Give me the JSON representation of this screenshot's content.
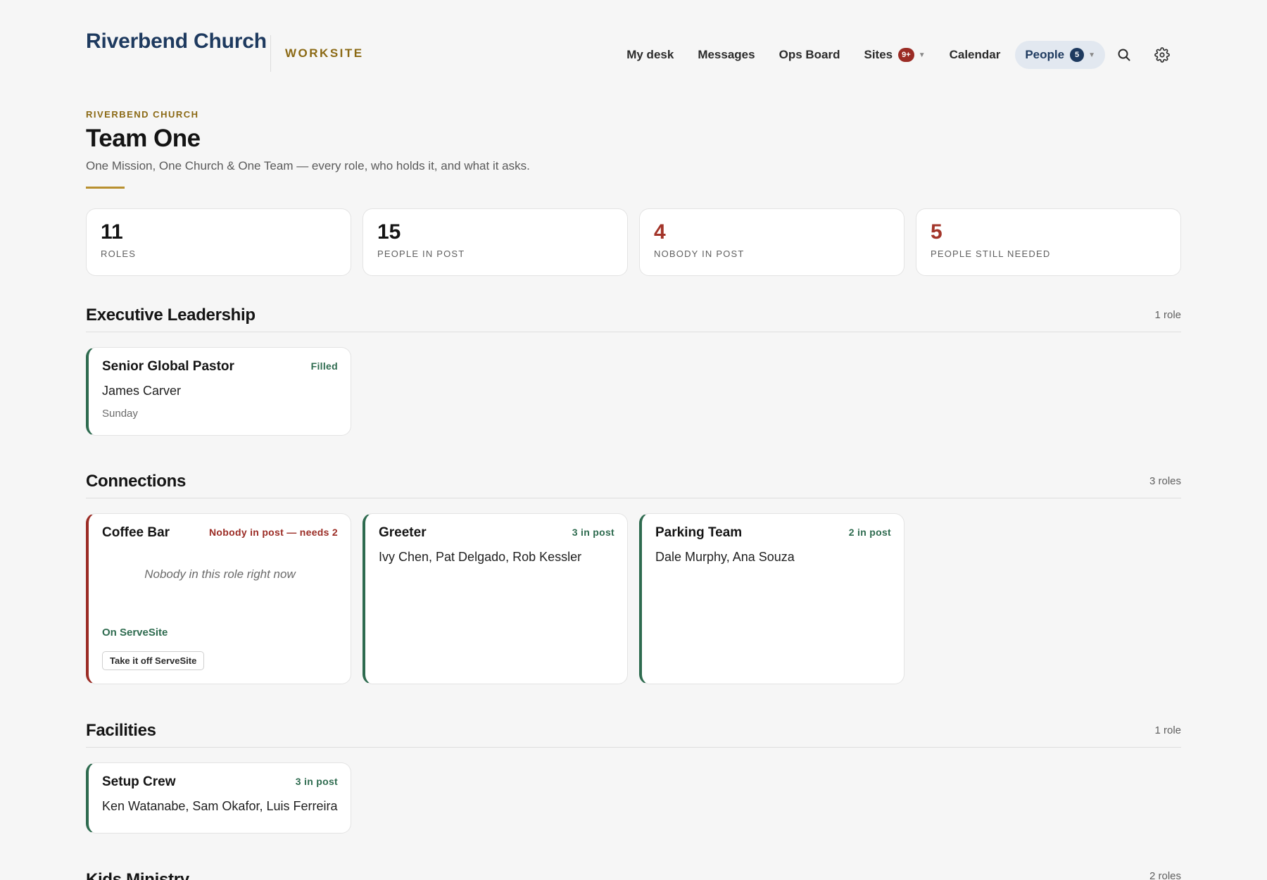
{
  "header": {
    "brand": "Riverbend Church",
    "workspace": "WORKSITE",
    "nav": {
      "my_desk": "My desk",
      "messages": "Messages",
      "ops_board": "Ops Board",
      "sites": "Sites",
      "sites_badge": "9+",
      "calendar": "Calendar",
      "people": "People",
      "people_badge": "5"
    }
  },
  "page": {
    "eyebrow": "RIVERBEND CHURCH",
    "title": "Team One",
    "subtitle": "One Mission, One Church & One Team — every role, who holds it, and what it asks."
  },
  "stats": [
    {
      "value": "11",
      "label": "ROLES"
    },
    {
      "value": "15",
      "label": "PEOPLE IN POST"
    },
    {
      "value": "4",
      "label": "NOBODY IN POST"
    },
    {
      "value": "5",
      "label": "PEOPLE STILL NEEDED"
    }
  ],
  "sections": {
    "executive": {
      "title": "Executive Leadership",
      "count": "1 role",
      "cards": [
        {
          "title": "Senior Global Pastor",
          "status": "Filled",
          "people": "James Carver",
          "meta": "Sunday"
        }
      ]
    },
    "connections": {
      "title": "Connections",
      "count": "3 roles",
      "cards": [
        {
          "title": "Coffee Bar",
          "status": "Nobody in post — needs 2",
          "empty_note": "Nobody in this role right now",
          "serve": "On ServeSite",
          "action": "Take it off ServeSite"
        },
        {
          "title": "Greeter",
          "status": "3 in post",
          "people": "Ivy Chen, Pat Delgado, Rob Kessler"
        },
        {
          "title": "Parking Team",
          "status": "2 in post",
          "people": "Dale Murphy, Ana Souza"
        }
      ]
    },
    "facilities": {
      "title": "Facilities",
      "count": "1 role",
      "cards": [
        {
          "title": "Setup Crew",
          "status": "3 in post",
          "people": "Ken Watanabe, Sam Okafor, Luis Ferreira"
        }
      ]
    },
    "kids": {
      "title": "Kids Ministry",
      "count": "2 roles"
    }
  },
  "icons": {
    "search": "search-icon",
    "settings": "gear-icon",
    "caret": "caret-down-icon"
  },
  "colors": {
    "brand": "#1e3a5f",
    "gold": "#8b6914",
    "filled": "#2e6b4f",
    "alert": "#9b2c25"
  }
}
